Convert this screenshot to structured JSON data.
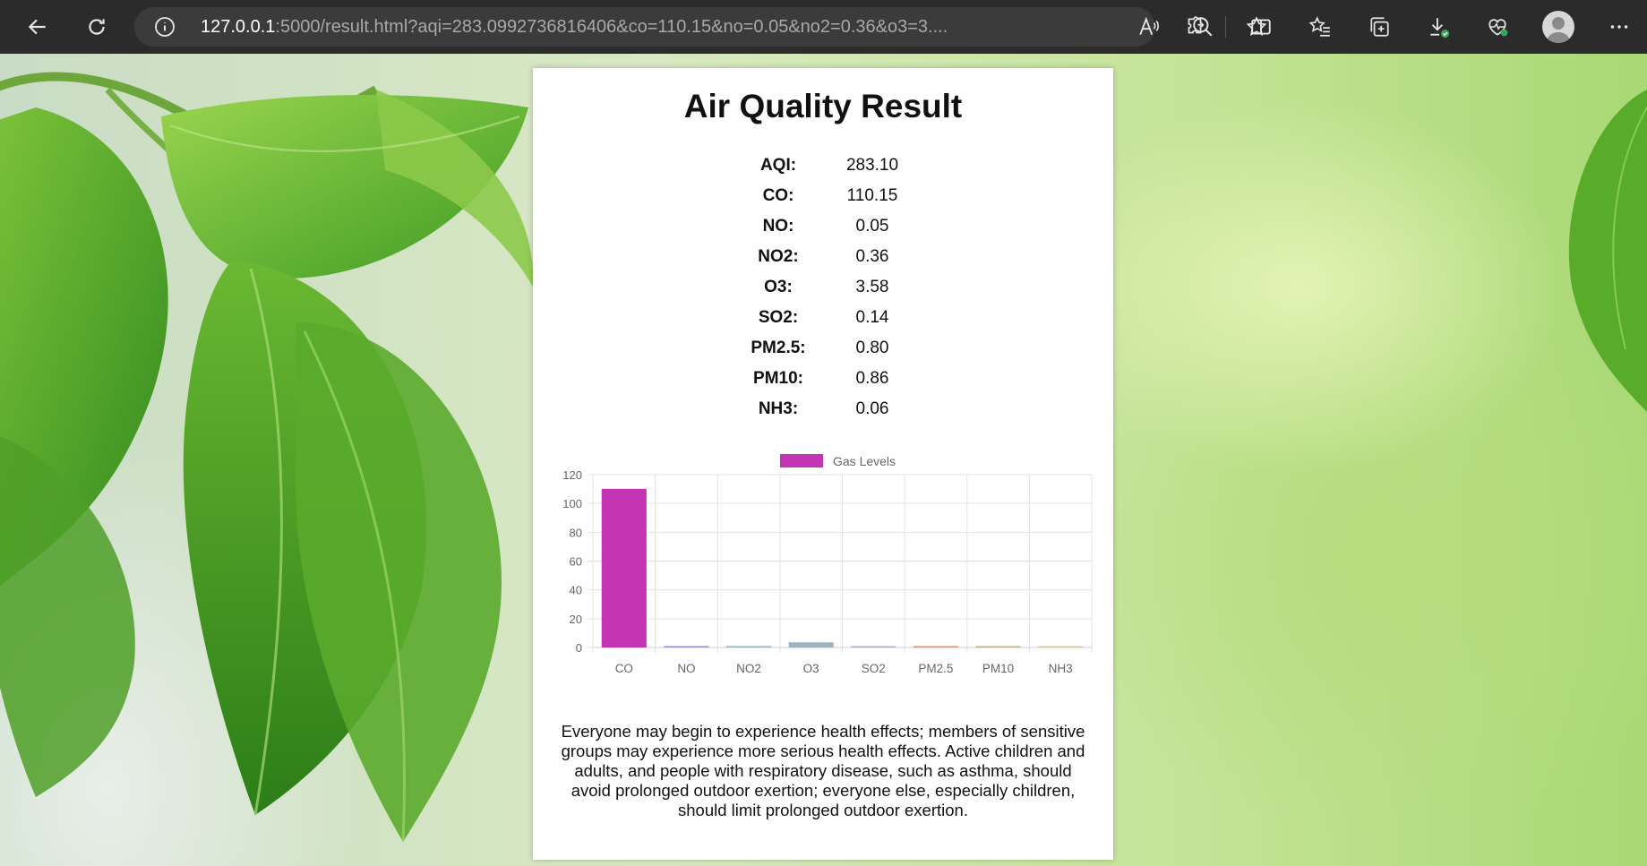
{
  "browser": {
    "url_host": "127.0.0.1",
    "url_rest": ":5000/result.html?aqi=283.0992736816406&co=110.15&no=0.05&no2=0.36&o3=3...."
  },
  "card": {
    "title": "Air Quality Result",
    "metrics": [
      {
        "label": "AQI:",
        "value": "283.10"
      },
      {
        "label": "CO:",
        "value": "110.15"
      },
      {
        "label": "NO:",
        "value": "0.05"
      },
      {
        "label": "NO2:",
        "value": "0.36"
      },
      {
        "label": "O3:",
        "value": "3.58"
      },
      {
        "label": "SO2:",
        "value": "0.14"
      },
      {
        "label": "PM2.5:",
        "value": "0.80"
      },
      {
        "label": "PM10:",
        "value": "0.86"
      },
      {
        "label": "NH3:",
        "value": "0.06"
      }
    ],
    "description": "Everyone may begin to experience health effects; members of sensitive groups may experience more serious health effects. Active children and adults, and people with respiratory disease, such as asthma, should avoid prolonged outdoor exertion; everyone else, especially children, should limit prolonged outdoor exertion."
  },
  "chart_data": {
    "type": "bar",
    "legend": "Gas Levels",
    "categories": [
      "CO",
      "NO",
      "NO2",
      "O3",
      "SO2",
      "PM2.5",
      "PM10",
      "NH3"
    ],
    "values": [
      110.15,
      0.05,
      0.36,
      3.58,
      0.14,
      0.8,
      0.86,
      0.06
    ],
    "colors": [
      "#c435b3",
      "#8f8fc9",
      "#8fb2c9",
      "#9fb3bf",
      "#b5a9c9",
      "#d2957a",
      "#bdb089",
      "#d8c49b"
    ],
    "legend_color": "#c435b3",
    "ylim": [
      0,
      120
    ],
    "yticks": [
      0,
      20,
      40,
      60,
      80,
      100,
      120
    ],
    "grid": true,
    "legend_position": "top"
  },
  "colors": {
    "toolbar_bg": "#2b2b2b",
    "address_bg": "#3b3b3b",
    "download_badge": "#3ba55c"
  }
}
